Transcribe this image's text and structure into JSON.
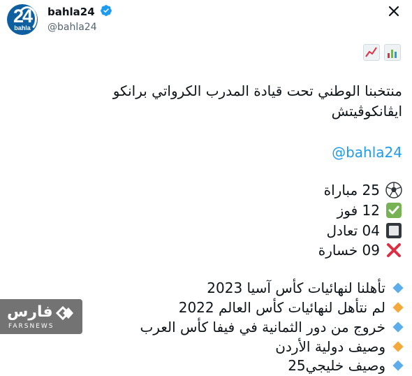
{
  "header": {
    "display_name": "bahla24",
    "handle": "@bahla24",
    "avatar_number": "24",
    "avatar_brand": "bahla"
  },
  "tweet": {
    "emojis": [
      "chart-bar-icon",
      "chart-increasing-icon"
    ],
    "headline_line1": "منتخبنا الوطني تحت قيادة المدرب الكرواتي برانكو",
    "headline_line2": "ايڤانكوڤيتش",
    "mention": "@bahla24",
    "stats": [
      {
        "icon": "soccer-ball-icon",
        "text": "25 مباراة"
      },
      {
        "icon": "check-mark-icon",
        "text": "12 فوز"
      },
      {
        "icon": "white-square-icon",
        "text": "04 تعادل"
      },
      {
        "icon": "cross-mark-icon",
        "text": "09 خسارة"
      }
    ],
    "achievements": [
      {
        "color": "blue",
        "text": "تأهلنا لنهائيات كأس آسيا 2023"
      },
      {
        "color": "orange",
        "text": "لم نتأهل لنهائيات كأس العالم 2022"
      },
      {
        "color": "blue",
        "text": "خروج من دور الثمانية في فيفا كأس العرب"
      },
      {
        "color": "orange",
        "text": "وصيف دولية الأردن"
      },
      {
        "color": "blue",
        "text": "وصيف خليجي25"
      }
    ]
  },
  "watermark": {
    "text": "فارس",
    "subtext": "FARSNEWS"
  },
  "colors": {
    "blue_diamond": "#5dadec",
    "orange_diamond": "#f4a93b",
    "verified": "#1d9bf0",
    "check": "#77b255",
    "cross": "#dd2e44"
  }
}
